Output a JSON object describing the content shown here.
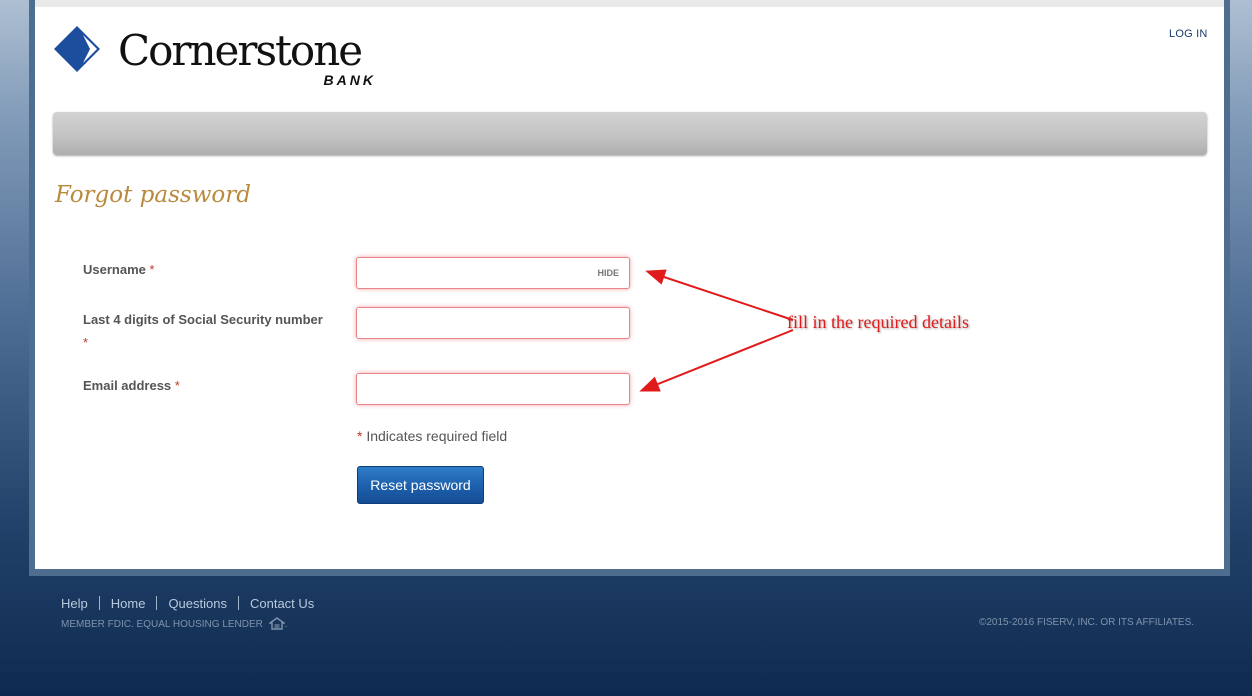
{
  "header": {
    "brand_name": "Cornerstone",
    "brand_sub": "BANK",
    "login_link": "LOG IN"
  },
  "form": {
    "title": "Forgot password",
    "username": {
      "label": "Username",
      "required_mark": "*",
      "hide_label": "HIDE",
      "value": ""
    },
    "ssn": {
      "label": "Last 4 digits of Social Security number",
      "required_mark": "*",
      "value": ""
    },
    "email": {
      "label": "Email address",
      "required_mark": "*",
      "value": ""
    },
    "required_note_mark": "*",
    "required_note": "Indicates required field",
    "submit_label": "Reset password"
  },
  "annotation": {
    "text": "fill in the required details",
    "color": "#e11b1b"
  },
  "footer": {
    "links": [
      "Help",
      "Home",
      "Questions",
      "Contact Us"
    ],
    "member_text": "MEMBER FDIC. EQUAL HOUSING LENDER",
    "member_suffix": ".",
    "copyright": "©2015-2016 FISERV, INC. OR ITS AFFILIATES."
  },
  "colors": {
    "brand_blue": "#1d4e9e",
    "title_gold": "#b98a3e",
    "button_blue": "#1d5fab",
    "required_red": "#c0392b"
  },
  "icons": {
    "logo": "diamond-chevron-logo",
    "housing": "equal-housing-icon"
  }
}
